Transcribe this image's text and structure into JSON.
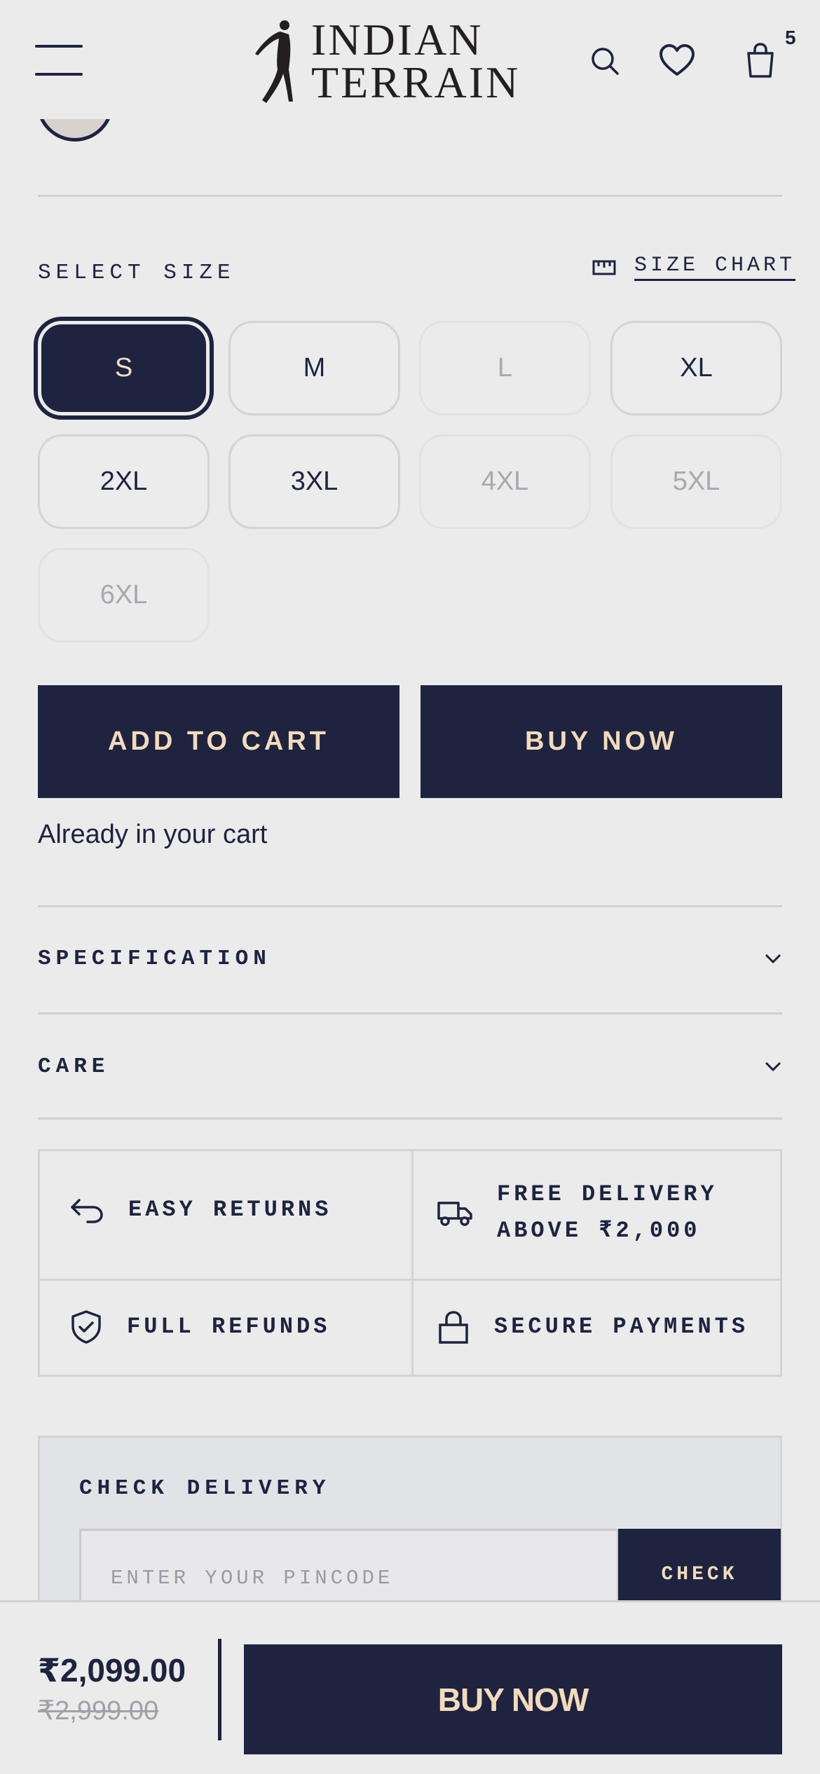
{
  "header": {
    "logo_line1": "INDIAN",
    "logo_line2": "TERRAIN",
    "cart_count": "5",
    "icons": [
      "menu-icon",
      "search-icon",
      "heart-icon",
      "bag-icon"
    ]
  },
  "size_section": {
    "label": "SELECT SIZE",
    "size_chart_label": "SIZE CHART",
    "sizes": [
      {
        "label": "S",
        "state": "selected"
      },
      {
        "label": "M",
        "state": "available"
      },
      {
        "label": "L",
        "state": "unavailable"
      },
      {
        "label": "XL",
        "state": "available"
      },
      {
        "label": "2XL",
        "state": "available"
      },
      {
        "label": "3XL",
        "state": "available"
      },
      {
        "label": "4XL",
        "state": "unavailable"
      },
      {
        "label": "5XL",
        "state": "unavailable"
      },
      {
        "label": "6XL",
        "state": "unavailable"
      }
    ]
  },
  "actions": {
    "add_to_cart": "ADD TO CART",
    "buy_now": "BUY NOW",
    "cart_note": "Already in your cart"
  },
  "accordions": [
    {
      "label": "SPECIFICATION"
    },
    {
      "label": "CARE"
    }
  ],
  "features": {
    "easy_returns": "EASY RETURNS",
    "free_delivery_line1": "FREE DELIVERY",
    "free_delivery_line2": "ABOVE ₹2,000",
    "full_refunds": "FULL REFUNDS",
    "secure_payments": "SECURE PAYMENTS"
  },
  "delivery": {
    "title": "CHECK DELIVERY",
    "placeholder": "ENTER YOUR PINCODE",
    "check_label": "CHECK"
  },
  "bottom_bar": {
    "price": "₹2,099.00",
    "mrp": "₹2,999.00",
    "buy_now": "BUY NOW"
  },
  "colors": {
    "navy": "#1e2340",
    "cream": "#f3dbba",
    "background": "#ebebeb"
  }
}
